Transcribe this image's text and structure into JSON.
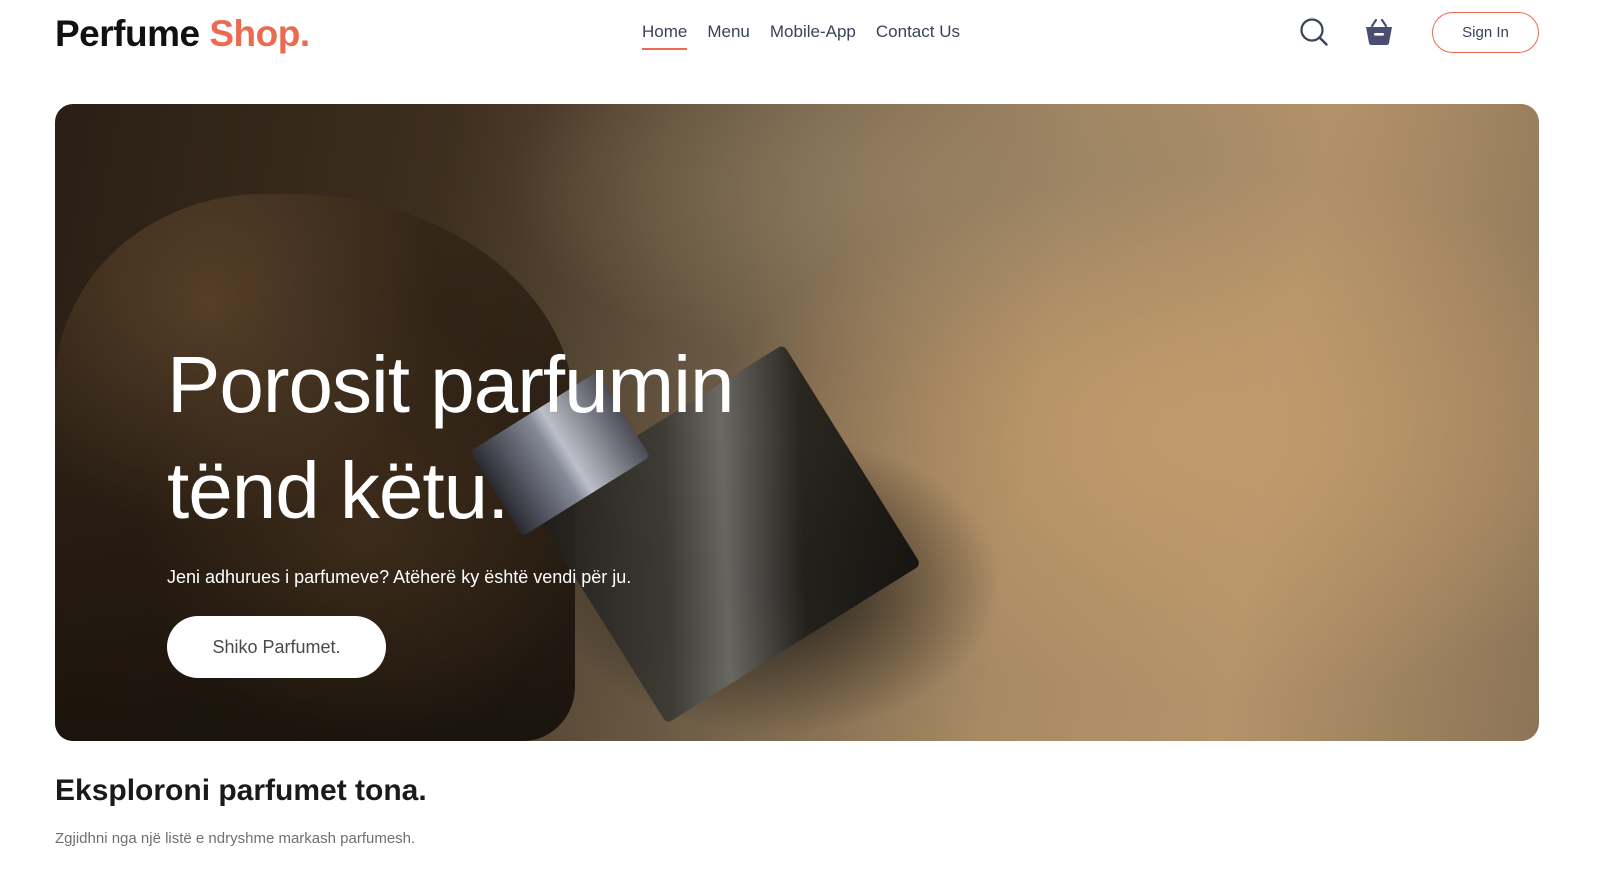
{
  "header": {
    "logo": {
      "main": "Perfume",
      "accent": "Shop."
    },
    "nav": [
      {
        "label": "Home",
        "active": true
      },
      {
        "label": "Menu",
        "active": false
      },
      {
        "label": "Mobile-App",
        "active": false
      },
      {
        "label": "Contact Us",
        "active": false
      }
    ],
    "icons": {
      "search": "search-icon",
      "cart": "basket-icon"
    },
    "signin_label": "Sign In"
  },
  "hero": {
    "title_line1": "Porosit parfumin",
    "title_line2": "tënd këtu.",
    "subtitle": "Jeni adhurues i parfumeve? Atëherë ky është vendi për ju.",
    "cta_label": "Shiko Parfumet."
  },
  "explore": {
    "title": "Eksploroni parfumet tona.",
    "subtitle": "Zgjidhni nga një listë e ndryshme markash parfumesh."
  },
  "colors": {
    "accent": "#ec6a52",
    "nav_text": "#3a4256",
    "cart_icon": "#4a4f72"
  }
}
